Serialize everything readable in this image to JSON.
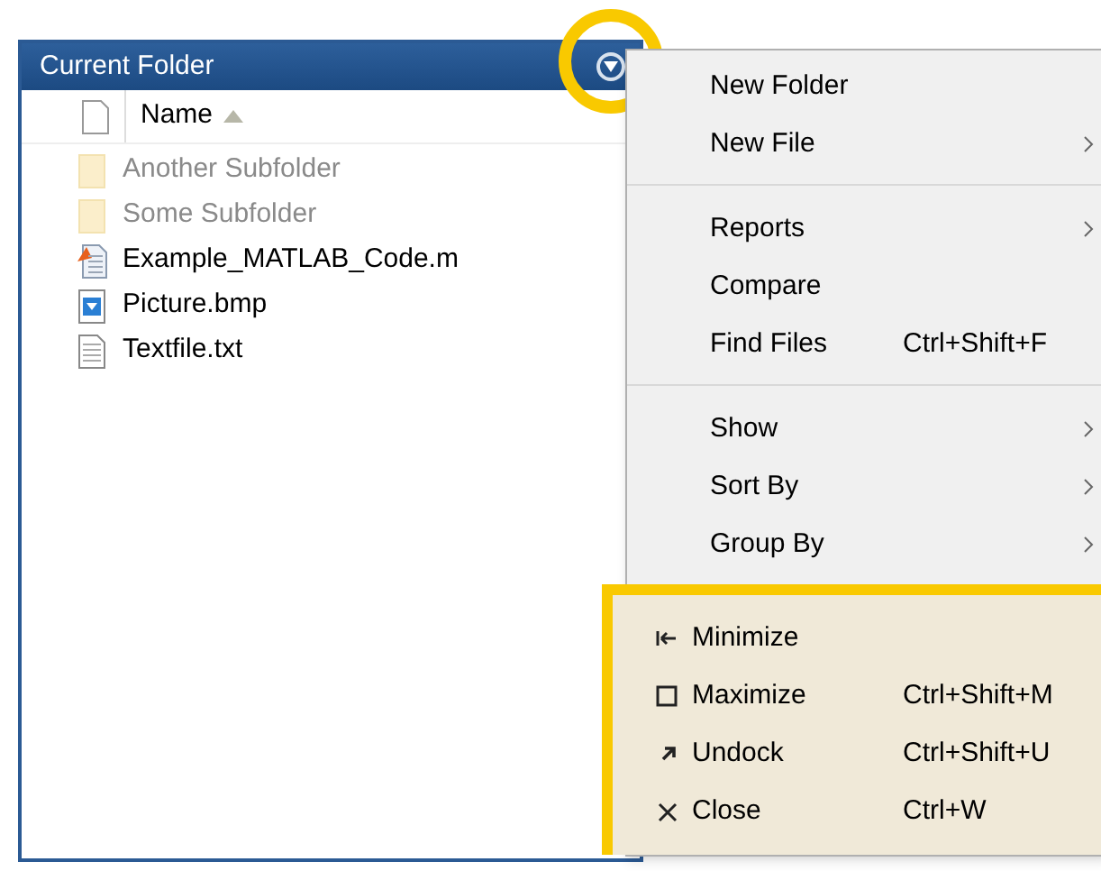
{
  "panel": {
    "title": "Current Folder",
    "menu_button": {
      "highlighted": true
    }
  },
  "columns": [
    {
      "label": "Name",
      "sorted": true
    }
  ],
  "files": [
    {
      "name": "Another Subfolder",
      "kind": "folder",
      "dimmed": true
    },
    {
      "name": "Some Subfolder",
      "kind": "folder",
      "dimmed": true
    },
    {
      "name": "Example_MATLAB_Code.m",
      "kind": "mfile",
      "dimmed": false
    },
    {
      "name": "Picture.bmp",
      "kind": "image",
      "dimmed": false
    },
    {
      "name": "Textfile.txt",
      "kind": "text",
      "dimmed": false
    }
  ],
  "menu": {
    "sections": [
      {
        "highlighted": false,
        "items": [
          {
            "label": "New Folder",
            "kind": "plain"
          },
          {
            "label": "New File",
            "kind": "submenu"
          }
        ]
      },
      {
        "highlighted": false,
        "items": [
          {
            "label": "Reports",
            "kind": "submenu"
          },
          {
            "label": "Compare",
            "kind": "plain"
          },
          {
            "label": "Find Files",
            "shortcut": "Ctrl+Shift+F",
            "kind": "plain"
          }
        ]
      },
      {
        "highlighted": false,
        "items": [
          {
            "label": "Show",
            "kind": "submenu"
          },
          {
            "label": "Sort By",
            "kind": "submenu"
          },
          {
            "label": "Group By",
            "kind": "submenu"
          }
        ]
      },
      {
        "highlighted": true,
        "items": [
          {
            "label": "Minimize",
            "kind": "minimize"
          },
          {
            "label": "Maximize",
            "kind": "maximize",
            "shortcut": "Ctrl+Shift+M"
          },
          {
            "label": "Undock",
            "kind": "undock",
            "shortcut": "Ctrl+Shift+U"
          },
          {
            "label": "Close",
            "kind": "close",
            "shortcut": "Ctrl+W"
          }
        ]
      }
    ]
  }
}
